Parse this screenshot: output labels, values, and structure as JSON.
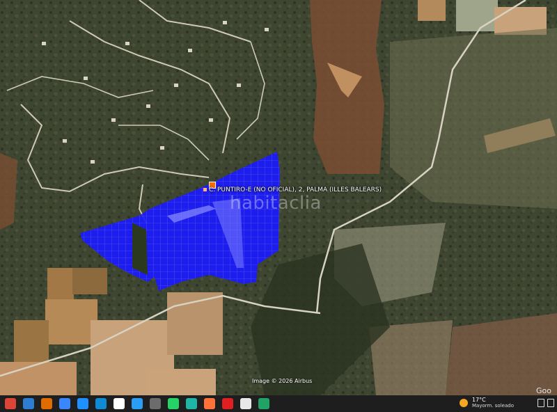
{
  "map": {
    "place_label": "C. PUNTIRO-E (NO OFICIAL), 2, PALMA (ILLES BALEARS)",
    "watermark": "habitaclia",
    "attribution": "Image © 2026 Airbus",
    "logo": "Goo",
    "overlay_color": "#1a1aff"
  },
  "taskbar": {
    "icons": [
      {
        "name": "chrome-icon",
        "color": "#db4437"
      },
      {
        "name": "app-icon-1",
        "color": "#2d7dd2"
      },
      {
        "name": "app-icon-2",
        "color": "#e06c00"
      },
      {
        "name": "app-icon-3",
        "color": "#3a86ff"
      },
      {
        "name": "photos-icon",
        "color": "#1e90ff"
      },
      {
        "name": "edge-icon",
        "color": "#0f8ad4"
      },
      {
        "name": "file-icon",
        "color": "#ffffff"
      },
      {
        "name": "app-icon-4",
        "color": "#2a9df4"
      },
      {
        "name": "app-icon-5",
        "color": "#6c6c6c"
      },
      {
        "name": "whatsapp-icon",
        "color": "#25d366"
      },
      {
        "name": "app-icon-6",
        "color": "#1fb6a6"
      },
      {
        "name": "firefox-icon",
        "color": "#ff7139"
      },
      {
        "name": "acrobat-icon",
        "color": "#e02020"
      },
      {
        "name": "app-icon-7",
        "color": "#e8e8e8"
      },
      {
        "name": "app-icon-8",
        "color": "#21a366"
      }
    ],
    "weather_temp": "17°C",
    "weather_desc": "Mayorm. soleado"
  }
}
